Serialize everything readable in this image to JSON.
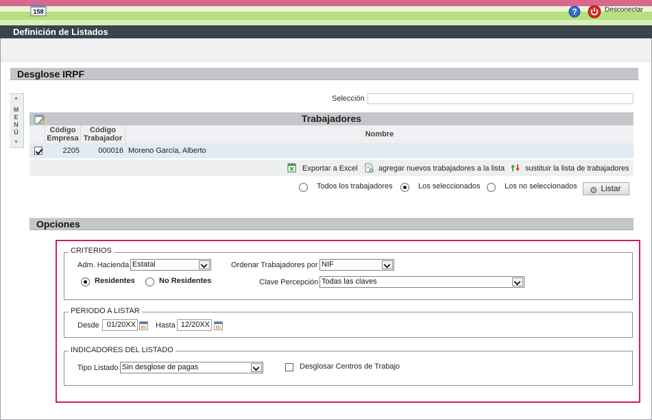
{
  "app": {
    "title": "Definición de Listados"
  },
  "toolbar": {
    "badge_count": "158",
    "disconnect_label": "Desconectar"
  },
  "side_tab": {
    "label": "MENÚ"
  },
  "section": {
    "title": "Desglose IRPF",
    "options_title": "Opciones"
  },
  "selection": {
    "label": "Selección",
    "value": ""
  },
  "grid": {
    "title": "Trabajadores",
    "columns": {
      "empresa": "Código Empresa",
      "trabajador": "Código Trabajador",
      "nombre": "Nombre"
    },
    "rows": [
      {
        "checked": true,
        "empresa": "2205",
        "trabajador": "000016",
        "nombre": "Moreno García, Alberto"
      }
    ],
    "footer": {
      "export": "Exportar a Excel",
      "add": "agregar nuevos trabajadores a la lista",
      "replace": "sustituir la lista de trabajadores"
    }
  },
  "filter": {
    "options": [
      "Todos los trabajadores",
      "Los seleccionados",
      "Los no seleccionados"
    ],
    "selected": "Los seleccionados",
    "list_button": "Listar"
  },
  "criterios": {
    "legend": "CRITERIOS",
    "adm_label": "Adm. Hacienda",
    "adm_value": "Estatal",
    "order_label": "Ordenar Trabajadores por",
    "order_value": "NIF",
    "residentes": "Residentes",
    "no_residentes": "No Residentes",
    "residency_selected": "Residentes",
    "clave_label": "Clave Percepción",
    "clave_value": "Todas las claves"
  },
  "periodo": {
    "legend": "PERIODO A LISTAR",
    "desde_label": "Desde",
    "desde_value": "01/20XX",
    "hasta_label": "Hasta",
    "hasta_value": "12/20XX"
  },
  "indicadores": {
    "legend": "INDICADORES DEL LISTADO",
    "tipo_label": "Tipo Listado",
    "tipo_value": "Sin desglose de pagas",
    "centros_label": "Desglosar Centros de Trabajo",
    "centros_checked": false
  }
}
